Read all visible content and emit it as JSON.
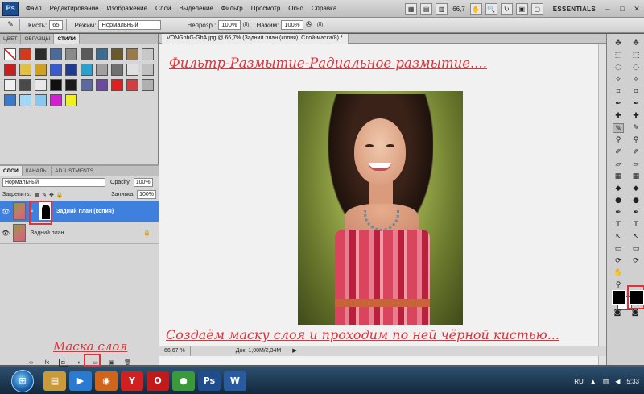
{
  "app": {
    "logo": "Ps",
    "menu": [
      "Файл",
      "Редактирование",
      "Изображение",
      "Слой",
      "Выделение",
      "Фильтр",
      "Просмотр",
      "Окно",
      "Справка"
    ],
    "zoom": "66,7",
    "workspace": "ESSENTIALS",
    "window_controls": [
      "–",
      "□",
      "✕"
    ]
  },
  "options_bar": {
    "brushes_label": "Кисть:",
    "brush_size": "65",
    "mode_label": "Режим:",
    "mode_value": "Нормальный",
    "opacity_label": "Непрозр.:",
    "opacity_value": "100%",
    "flow_label": "Нажим:",
    "flow_value": "100%"
  },
  "styles_panel": {
    "tabs": [
      "ЦВЕТ",
      "ОБРАЗЦЫ",
      "СТИЛИ"
    ],
    "active_tab": "СТИЛИ",
    "swatches": [
      "#ffffff",
      "#d23a1a",
      "#2c2c2c",
      "#4a6a9a",
      "#8a8a8a",
      "#5a5a5a",
      "#3d6b8f",
      "#6a5a2a",
      "#9a7a4a",
      "#c8c8c8",
      "#c82020",
      "#e0c040",
      "#d0a020",
      "#3a5ad0",
      "#203a90",
      "#2aa0d0",
      "#a0a0a0",
      "#707070",
      "#e0e0e0",
      "#c0c0c0",
      "#f0f0f0",
      "#4a4a4a",
      "#e8e8e8",
      "#101010",
      "#1a1a1a",
      "#5a6aa0",
      "#6a4aa0",
      "#e02020",
      "#d04040",
      "#b0b0b0",
      "#3a7ac8",
      "#a0d8f8",
      "#88c8f0",
      "#d020d0",
      "#f0f020"
    ]
  },
  "layers_panel": {
    "tabs": [
      "СЛОИ",
      "КАНАЛЫ",
      "ADJUSTMENTS"
    ],
    "active_tab": "СЛОИ",
    "blend_mode": "Нормальный",
    "opacity_label": "Opacity:",
    "opacity_value": "100%",
    "lock_label": "Закрепить:",
    "fill_label": "Заливка:",
    "fill_value": "100%",
    "layers": [
      {
        "name": "Задний план (копия)",
        "selected": true,
        "has_mask": true
      },
      {
        "name": "Задний план",
        "selected": false,
        "has_mask": false
      }
    ],
    "footer_icons": [
      "link-icon",
      "fx-icon",
      "add-mask-icon",
      "adjustment-icon",
      "group-icon",
      "new-layer-icon",
      "trash-icon"
    ],
    "footer_glyphs": [
      "∞",
      "fx",
      "◘",
      "◐",
      "▭",
      "▣",
      "🗑"
    ]
  },
  "document": {
    "tab_title": "VONGbhG-GbA.jpg @ 66,7% (Задний план (копия), Слой-маска/8) *",
    "caption_top": "Фильтр-Размытие-Радиальное размытие....",
    "caption_bottom": "Создаём маску слоя и проходим по ней чёрной кистью...",
    "zoom_status": "66,67 %",
    "doc_size": "Док: 1,00M/2,34M"
  },
  "caption_mask": "Маска слоя",
  "taskbar": {
    "lang": "RU",
    "time": "5:33",
    "apps": [
      {
        "name": "explorer",
        "glyph": "▤",
        "color": "#c99a3a"
      },
      {
        "name": "media",
        "glyph": "▶",
        "color": "#2a7ad0"
      },
      {
        "name": "firefox",
        "glyph": "◉",
        "color": "#d0641a"
      },
      {
        "name": "yandex",
        "glyph": "Y",
        "color": "#d02020"
      },
      {
        "name": "opera",
        "glyph": "O",
        "color": "#c01a1a"
      },
      {
        "name": "chrome",
        "glyph": "●",
        "color": "#3a9a3a"
      },
      {
        "name": "photoshop",
        "glyph": "Ps",
        "color": "#1e4c8c"
      },
      {
        "name": "word",
        "glyph": "W",
        "color": "#2a5aa0"
      }
    ]
  },
  "colors": {
    "accent_red": "#e0323a",
    "selection_blue": "#3f7fdd"
  }
}
